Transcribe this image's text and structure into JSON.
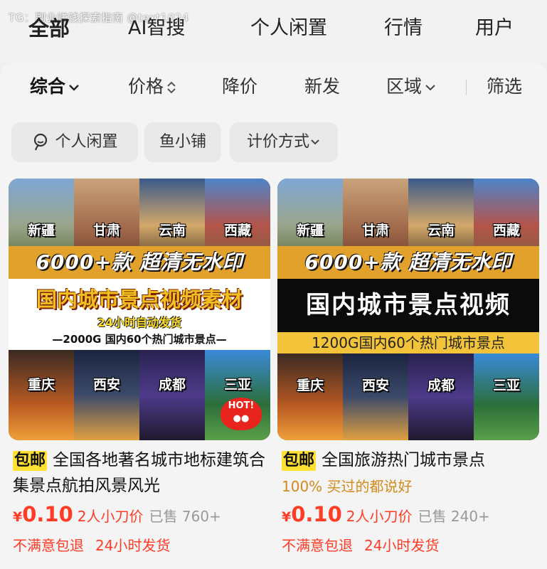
{
  "watermark": "TG：副业赚钱探索指南 @text1024",
  "tabs": [
    {
      "label": "全部",
      "active": true
    },
    {
      "label": "AI智搜"
    },
    {
      "label": "个人闲置"
    },
    {
      "label": "行情"
    },
    {
      "label": "用户"
    }
  ],
  "sort_bar": {
    "items": [
      {
        "label": "综合",
        "icon": "chevron-down-icon",
        "active": true
      },
      {
        "label": "价格",
        "icon": "sort-updown-icon"
      },
      {
        "label": "降价"
      },
      {
        "label": "新发"
      },
      {
        "label": "区域",
        "icon": "chevron-down-icon"
      }
    ],
    "filter_label": "筛选"
  },
  "chips": [
    {
      "label": "个人闲置",
      "icon": "person-icon"
    },
    {
      "label": "鱼小铺"
    },
    {
      "label": "计价方式",
      "icon": "chevron-down-icon"
    }
  ],
  "products": [
    {
      "thumb": {
        "tiles_top": [
          "新疆",
          "甘肃",
          "云南",
          "西藏"
        ],
        "tiles_bottom": [
          "重庆",
          "西安",
          "成都",
          "三亚"
        ],
        "banner": "6000+款  超清无水印",
        "main": "国内城市景点视频素材",
        "sub": "24小时自动发货",
        "sub2": "—2000G 国内60个热门城市景点—",
        "hot": "HOT!"
      },
      "badge": "包邮",
      "title": "全国各地著名城市地标建筑合集景点航拍风景风光",
      "price_symbol": "¥",
      "price": "0.10",
      "kanjia": "2人小刀价",
      "sold": "已售 760+",
      "tags": [
        "不满意包退",
        "24小时发货"
      ]
    },
    {
      "thumb": {
        "tiles_top": [
          "新疆",
          "甘肃",
          "云南",
          "西藏"
        ],
        "tiles_bottom": [
          "重庆",
          "西安",
          "成都",
          "三亚"
        ],
        "banner": "6000+款  超清无水印",
        "main": "国内城市景点视频",
        "sub": "1200G国内60个热门城市景点"
      },
      "badge": "包邮",
      "title": "全国旅游热门城市景点",
      "praise": "100% 买过的都说好",
      "price_symbol": "¥",
      "price": "0.10",
      "kanjia": "2人小刀价",
      "sold": "已售 240+",
      "tags": [
        "不满意包退",
        "24小时发货"
      ]
    }
  ]
}
